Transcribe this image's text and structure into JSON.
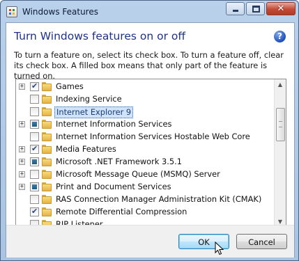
{
  "window": {
    "title": "Windows Features",
    "caption_buttons": [
      "minimize",
      "maximize",
      "close"
    ]
  },
  "dialog": {
    "heading": "Turn Windows features on or off",
    "help_icon": "?",
    "description": "To turn a feature on, select its check box. To turn a feature off, clear its check box. A filled box means that only part of the feature is turned on."
  },
  "features": [
    {
      "label": "Games",
      "expandable": true,
      "state": "checked",
      "selected": false
    },
    {
      "label": "Indexing Service",
      "expandable": false,
      "state": "unchecked",
      "selected": false
    },
    {
      "label": "Internet Explorer 9",
      "expandable": false,
      "state": "unchecked",
      "selected": true
    },
    {
      "label": "Internet Information Services",
      "expandable": true,
      "state": "partial",
      "selected": false
    },
    {
      "label": "Internet Information Services Hostable Web Core",
      "expandable": false,
      "state": "unchecked",
      "selected": false
    },
    {
      "label": "Media Features",
      "expandable": true,
      "state": "checked",
      "selected": false
    },
    {
      "label": "Microsoft .NET Framework 3.5.1",
      "expandable": true,
      "state": "partial",
      "selected": false
    },
    {
      "label": "Microsoft Message Queue (MSMQ) Server",
      "expandable": true,
      "state": "unchecked",
      "selected": false
    },
    {
      "label": "Print and Document Services",
      "expandable": true,
      "state": "partial",
      "selected": false
    },
    {
      "label": "RAS Connection Manager Administration Kit (CMAK)",
      "expandable": false,
      "state": "unchecked",
      "selected": false
    },
    {
      "label": "Remote Differential Compression",
      "expandable": false,
      "state": "checked",
      "selected": false
    },
    {
      "label": "RIP Listener",
      "expandable": false,
      "state": "unchecked",
      "selected": false
    }
  ],
  "buttons": {
    "ok": "OK",
    "cancel": "Cancel"
  },
  "colors": {
    "heading": "#1e3287",
    "selection": "#cfe4fb",
    "ok_border": "#3c7fb1"
  }
}
